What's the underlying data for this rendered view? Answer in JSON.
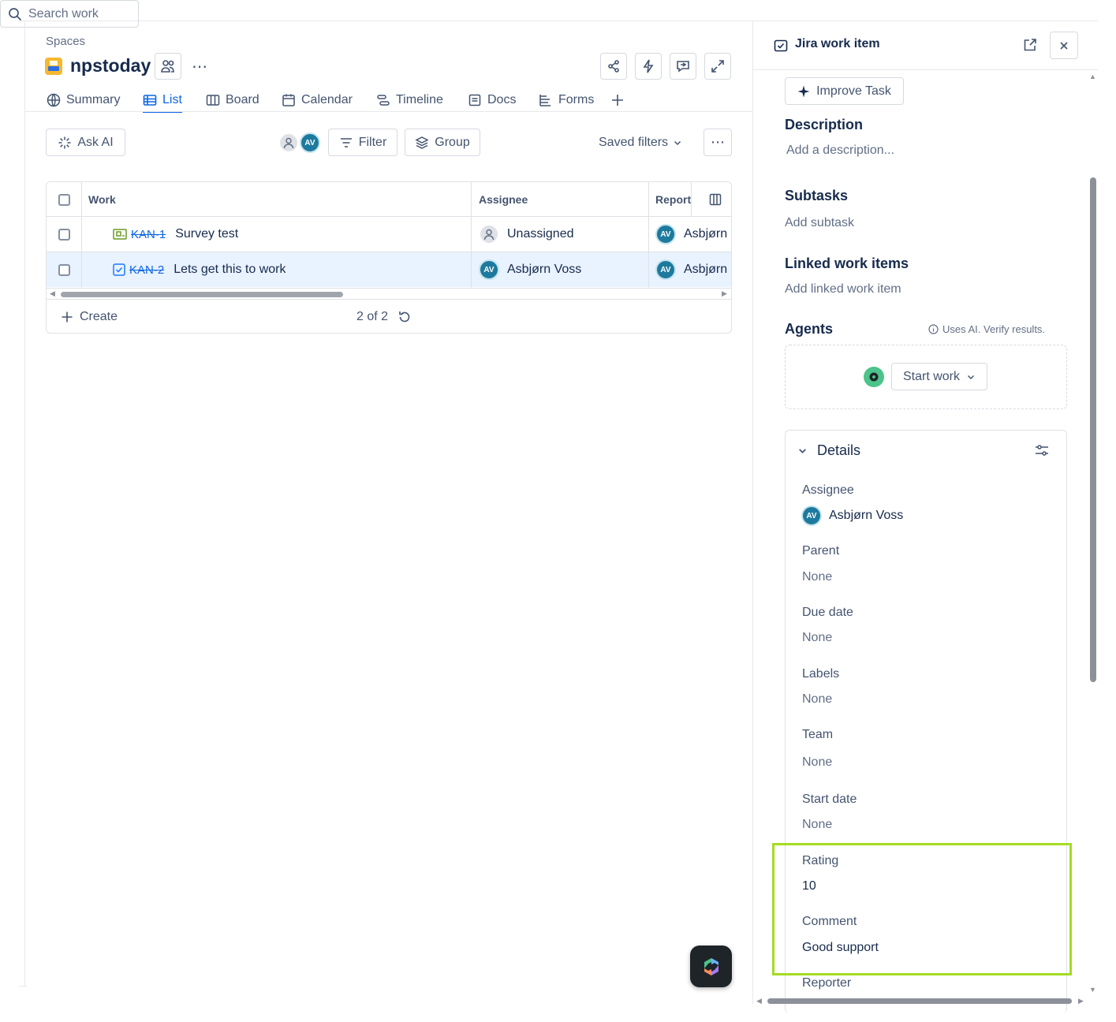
{
  "breadcrumb": "Spaces",
  "project": {
    "title": "npstoday",
    "more_label": "⋯"
  },
  "tabs": [
    {
      "label": "Summary",
      "icon": "globe-icon"
    },
    {
      "label": "List",
      "icon": "list-icon",
      "active": true
    },
    {
      "label": "Board",
      "icon": "board-icon"
    },
    {
      "label": "Calendar",
      "icon": "calendar-icon"
    },
    {
      "label": "Timeline",
      "icon": "timeline-icon"
    },
    {
      "label": "Docs",
      "icon": "docs-icon"
    },
    {
      "label": "Forms",
      "icon": "forms-icon"
    }
  ],
  "toolbar": {
    "ask_ai": "Ask AI",
    "search_placeholder": "Search work",
    "avatar_initials": "AV",
    "filter": "Filter",
    "group": "Group",
    "saved_filters": "Saved filters",
    "more_label": "⋯"
  },
  "table": {
    "headers": {
      "work": "Work",
      "assignee": "Assignee",
      "reporter": "Report"
    },
    "rows": [
      {
        "key": "KAN-1",
        "summary": "Survey test",
        "assignee": "Unassigned",
        "reporter": "Asbjørn",
        "reporter_initials": "AV"
      },
      {
        "key": "KAN-2",
        "summary": "Lets get this to work",
        "assignee": "Asbjørn Voss",
        "assignee_initials": "AV",
        "reporter": "Asbjørn",
        "reporter_initials": "AV"
      }
    ],
    "create_label": "Create",
    "count": "2 of 2"
  },
  "panel": {
    "title": "Jira work item",
    "improve_task": "Improve Task",
    "description_heading": "Description",
    "description_placeholder": "Add a description...",
    "subtasks_heading": "Subtasks",
    "subtasks_action": "Add subtask",
    "linked_heading": "Linked work items",
    "linked_action": "Add linked work item",
    "agents_heading": "Agents",
    "agents_note": "Uses AI. Verify results.",
    "start_work": "Start work",
    "details_heading": "Details",
    "details": {
      "assignee_label": "Assignee",
      "assignee_value": "Asbjørn Voss",
      "assignee_initials": "AV",
      "parent_label": "Parent",
      "parent_value": "None",
      "due_label": "Due date",
      "due_value": "None",
      "labels_label": "Labels",
      "labels_value": "None",
      "team_label": "Team",
      "team_value": "None",
      "start_label": "Start date",
      "start_value": "None",
      "rating_label": "Rating",
      "rating_value": "10",
      "comment_label": "Comment",
      "comment_value": "Good support",
      "reporter_label": "Reporter"
    }
  },
  "colors": {
    "accent": "#0c66e4",
    "highlight": "#a4dc22",
    "avatar": "#1d7a9e"
  }
}
